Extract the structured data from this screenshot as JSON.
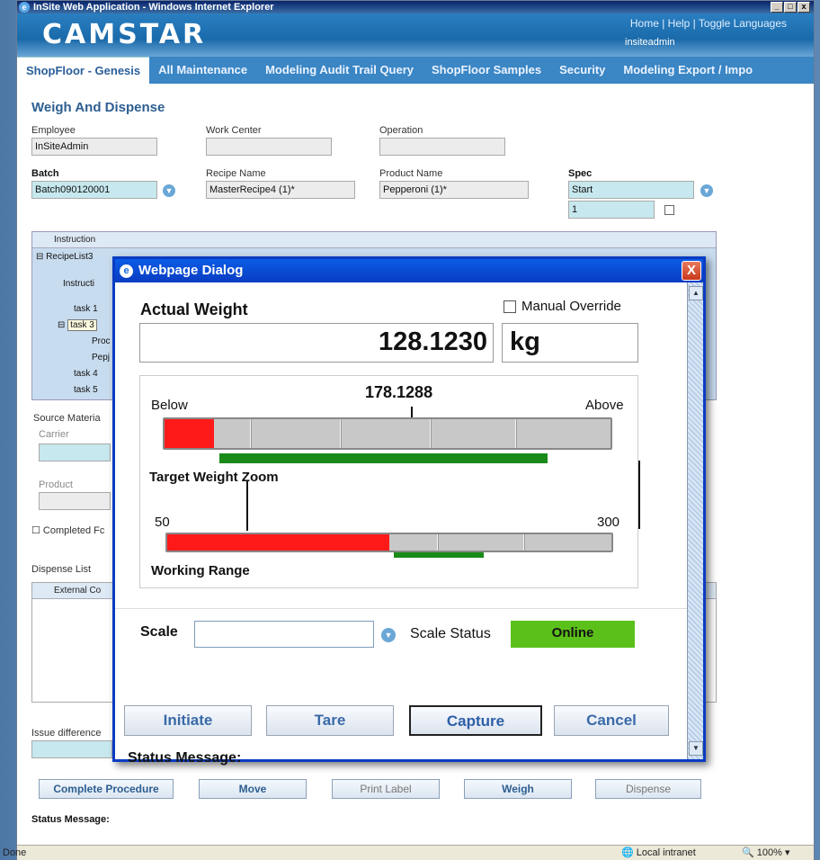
{
  "window": {
    "title": "InSite Web Application - Windows Internet Explorer",
    "minimize": "_",
    "maximize": "□",
    "close": "x"
  },
  "header": {
    "logo": "CAMSTAR",
    "links": "Home  |  Help  |  Toggle Languages",
    "user": "insiteadmin"
  },
  "tabs": [
    {
      "label": "ShopFloor - Genesis"
    },
    {
      "label": "All Maintenance"
    },
    {
      "label": "Modeling Audit Trail Query"
    },
    {
      "label": "ShopFloor Samples"
    },
    {
      "label": "Security"
    },
    {
      "label": "Modeling Export / Impo"
    }
  ],
  "page": {
    "title": "Weigh And Dispense",
    "employee_label": "Employee",
    "employee_value": "InSiteAdmin",
    "workcenter_label": "Work Center",
    "workcenter_value": "",
    "operation_label": "Operation",
    "operation_value": "",
    "batch_label": "Batch",
    "batch_value": "Batch090120001",
    "recipe_label": "Recipe Name",
    "recipe_value": "MasterRecipe4 (1)*",
    "product_label": "Product Name",
    "product_value": "Pepperoni (1)*",
    "spec_label": "Spec",
    "spec_value": "Start",
    "spec_rev": "1",
    "grid": {
      "header": "Instruction",
      "rows": [
        "RecipeList3",
        "Instructi",
        "task 1",
        "task 3",
        "Proc",
        "Pepj",
        "task 4",
        "task 5"
      ]
    },
    "source_label": "Source Materia",
    "carrier_label": "Carrier",
    "product2_label": "Product",
    "completed_label": "Completed Fc",
    "dispense_label": "Dispense List",
    "dispense_col": "External Co",
    "issue_label": "Issue difference",
    "status_label": "Status Message:",
    "buttons": {
      "complete": "Complete Procedure",
      "move": "Move",
      "print": "Print Label",
      "weigh": "Weigh",
      "dispense": "Dispense"
    }
  },
  "statusbar": {
    "left": "Done",
    "zone": "Local intranet",
    "zoom": "100%"
  },
  "dialog": {
    "title": "Webpage Dialog",
    "close": "X",
    "actual_weight_label": "Actual Weight",
    "manual_override_label": "Manual Override",
    "actual_weight_value": "128.1230",
    "unit": "kg",
    "zoom_gauge": {
      "target_value": "178.1288",
      "below_label": "Below",
      "above_label": "Above",
      "title": "Target Weight Zoom",
      "red_fill": 0.11
    },
    "range_gauge": {
      "min": "50",
      "max": "300",
      "title": "Working Range",
      "red_fill": 0.5
    },
    "scale_label": "Scale",
    "scale_value": "",
    "scale_status_label": "Scale Status",
    "scale_status_value": "Online",
    "buttons": {
      "initiate": "Initiate",
      "tare": "Tare",
      "capture": "Capture",
      "cancel": "Cancel"
    },
    "status_label": "Status Message:"
  },
  "colors": {
    "red": "#ff1a1a",
    "green": "#1a8a1a",
    "online": "#5cc01a"
  }
}
